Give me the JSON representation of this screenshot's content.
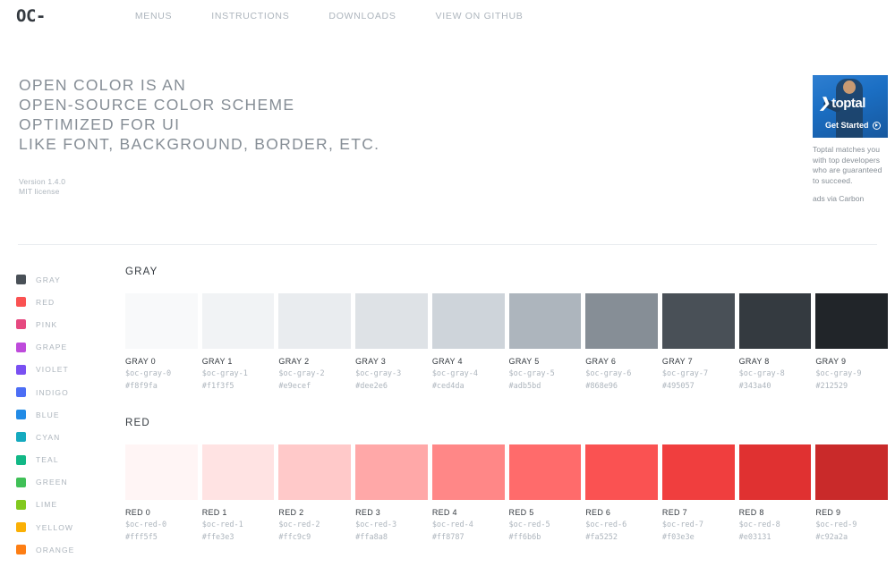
{
  "header": {
    "logo": "OC-",
    "nav": [
      {
        "label": "MENUS",
        "name": "nav-menus"
      },
      {
        "label": "INSTRUCTIONS",
        "name": "nav-instructions"
      },
      {
        "label": "DOWNLOADS",
        "name": "nav-downloads"
      },
      {
        "label": "VIEW ON GITHUB",
        "name": "nav-view-on-github"
      }
    ]
  },
  "hero": {
    "lines": [
      "OPEN COLOR IS AN",
      "OPEN-SOURCE COLOR SCHEME",
      "OPTIMIZED FOR UI",
      "LIKE FONT, BACKGROUND, BORDER, ETC."
    ],
    "version": "Version 1.4.0",
    "license": "MIT license"
  },
  "ad": {
    "brand": "toptal",
    "cta": "Get Started",
    "text": "Toptal matches you with top developers who are guaranteed to succeed.",
    "via": "ads via Carbon"
  },
  "sidebar": {
    "items": [
      {
        "label": "GRAY",
        "color": "#495057"
      },
      {
        "label": "RED",
        "color": "#fa5252"
      },
      {
        "label": "PINK",
        "color": "#e64980"
      },
      {
        "label": "GRAPE",
        "color": "#be4bdb"
      },
      {
        "label": "VIOLET",
        "color": "#7950f2"
      },
      {
        "label": "INDIGO",
        "color": "#4c6ef5"
      },
      {
        "label": "BLUE",
        "color": "#228be6"
      },
      {
        "label": "CYAN",
        "color": "#15aabf"
      },
      {
        "label": "TEAL",
        "color": "#12b886"
      },
      {
        "label": "GREEN",
        "color": "#40c057"
      },
      {
        "label": "LIME",
        "color": "#82c91e"
      },
      {
        "label": "YELLOW",
        "color": "#fab005"
      },
      {
        "label": "ORANGE",
        "color": "#fd7e14"
      }
    ]
  },
  "sections": [
    {
      "title": "GRAY",
      "swatches": [
        {
          "name": "GRAY 0",
          "var": "$oc-gray-0",
          "hex": "#f8f9fa"
        },
        {
          "name": "GRAY 1",
          "var": "$oc-gray-1",
          "hex": "#f1f3f5"
        },
        {
          "name": "GRAY 2",
          "var": "$oc-gray-2",
          "hex": "#e9ecef"
        },
        {
          "name": "GRAY 3",
          "var": "$oc-gray-3",
          "hex": "#dee2e6"
        },
        {
          "name": "GRAY 4",
          "var": "$oc-gray-4",
          "hex": "#ced4da"
        },
        {
          "name": "GRAY 5",
          "var": "$oc-gray-5",
          "hex": "#adb5bd"
        },
        {
          "name": "GRAY 6",
          "var": "$oc-gray-6",
          "hex": "#868e96"
        },
        {
          "name": "GRAY 7",
          "var": "$oc-gray-7",
          "hex": "#495057"
        },
        {
          "name": "GRAY 8",
          "var": "$oc-gray-8",
          "hex": "#343a40"
        },
        {
          "name": "GRAY 9",
          "var": "$oc-gray-9",
          "hex": "#212529"
        }
      ]
    },
    {
      "title": "RED",
      "swatches": [
        {
          "name": "RED 0",
          "var": "$oc-red-0",
          "hex": "#fff5f5"
        },
        {
          "name": "RED 1",
          "var": "$oc-red-1",
          "hex": "#ffe3e3"
        },
        {
          "name": "RED 2",
          "var": "$oc-red-2",
          "hex": "#ffc9c9"
        },
        {
          "name": "RED 3",
          "var": "$oc-red-3",
          "hex": "#ffa8a8"
        },
        {
          "name": "RED 4",
          "var": "$oc-red-4",
          "hex": "#ff8787"
        },
        {
          "name": "RED 5",
          "var": "$oc-red-5",
          "hex": "#ff6b6b"
        },
        {
          "name": "RED 6",
          "var": "$oc-red-6",
          "hex": "#fa5252"
        },
        {
          "name": "RED 7",
          "var": "$oc-red-7",
          "hex": "#f03e3e"
        },
        {
          "name": "RED 8",
          "var": "$oc-red-8",
          "hex": "#e03131"
        },
        {
          "name": "RED 9",
          "var": "$oc-red-9",
          "hex": "#c92a2a"
        }
      ]
    }
  ]
}
